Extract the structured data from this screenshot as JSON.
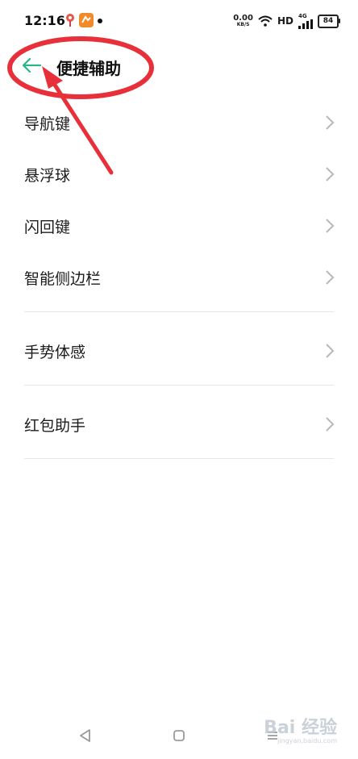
{
  "status_bar": {
    "time": "12:16",
    "net_speed_value": "0.00",
    "net_speed_unit": "KB/S",
    "hd_label": "HD",
    "network_label": "4G",
    "battery_level": "84"
  },
  "header": {
    "title": "便捷辅助",
    "back_icon": "arrow-left-icon"
  },
  "items": [
    {
      "label": "导航键"
    },
    {
      "label": "悬浮球"
    },
    {
      "label": "闪回键"
    },
    {
      "label": "智能侧边栏"
    },
    {
      "label": "手势体感"
    },
    {
      "label": "红包助手"
    }
  ],
  "watermark": {
    "text": "Bai 经验",
    "sub": "jingyan.baidu.com"
  },
  "colors": {
    "accent": "#2bb68a",
    "annotation": "#e8303a"
  }
}
